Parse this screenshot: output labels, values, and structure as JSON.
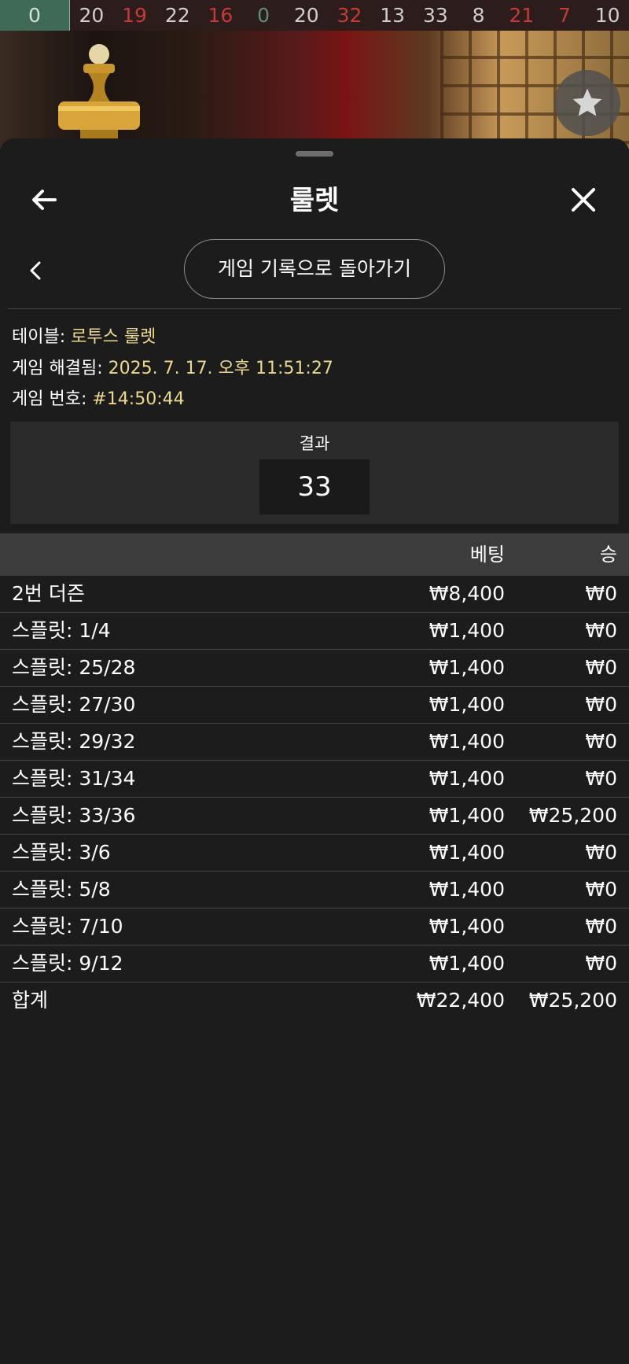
{
  "history": [
    {
      "n": "0",
      "color": "green"
    },
    {
      "n": "20",
      "color": "white"
    },
    {
      "n": "19",
      "color": "red"
    },
    {
      "n": "22",
      "color": "white"
    },
    {
      "n": "16",
      "color": "red"
    },
    {
      "n": "0",
      "color": "green"
    },
    {
      "n": "20",
      "color": "white"
    },
    {
      "n": "32",
      "color": "red"
    },
    {
      "n": "13",
      "color": "white"
    },
    {
      "n": "33",
      "color": "white"
    },
    {
      "n": "8",
      "color": "white"
    },
    {
      "n": "21",
      "color": "red"
    },
    {
      "n": "7",
      "color": "red"
    },
    {
      "n": "10",
      "color": "white"
    }
  ],
  "header": {
    "title": "룰렛"
  },
  "nav": {
    "back_to_history": "게임 기록으로 돌아가기"
  },
  "info": {
    "table_label": "테이블: ",
    "table_value": "로투스 룰렛",
    "resolved_label": "게임 해결됨: ",
    "resolved_value": "2025. 7. 17. 오후 11:51:27",
    "game_label": "게임 번호: ",
    "game_value": "#14:50:44"
  },
  "result": {
    "label": "결과",
    "value": "33"
  },
  "table": {
    "col_bet": "베팅",
    "col_win": "승",
    "rows": [
      {
        "name": "2번 더즌",
        "bet": "₩8,400",
        "win": "₩0"
      },
      {
        "name": "스플릿: 1/4",
        "bet": "₩1,400",
        "win": "₩0"
      },
      {
        "name": "스플릿: 25/28",
        "bet": "₩1,400",
        "win": "₩0"
      },
      {
        "name": "스플릿: 27/30",
        "bet": "₩1,400",
        "win": "₩0"
      },
      {
        "name": "스플릿: 29/32",
        "bet": "₩1,400",
        "win": "₩0"
      },
      {
        "name": "스플릿: 31/34",
        "bet": "₩1,400",
        "win": "₩0"
      },
      {
        "name": "스플릿: 33/36",
        "bet": "₩1,400",
        "win": "₩25,200"
      },
      {
        "name": "스플릿: 3/6",
        "bet": "₩1,400",
        "win": "₩0"
      },
      {
        "name": "스플릿: 5/8",
        "bet": "₩1,400",
        "win": "₩0"
      },
      {
        "name": "스플릿: 7/10",
        "bet": "₩1,400",
        "win": "₩0"
      },
      {
        "name": "스플릿: 9/12",
        "bet": "₩1,400",
        "win": "₩0"
      }
    ],
    "total": {
      "name": "합계",
      "bet": "₩22,400",
      "win": "₩25,200"
    }
  }
}
